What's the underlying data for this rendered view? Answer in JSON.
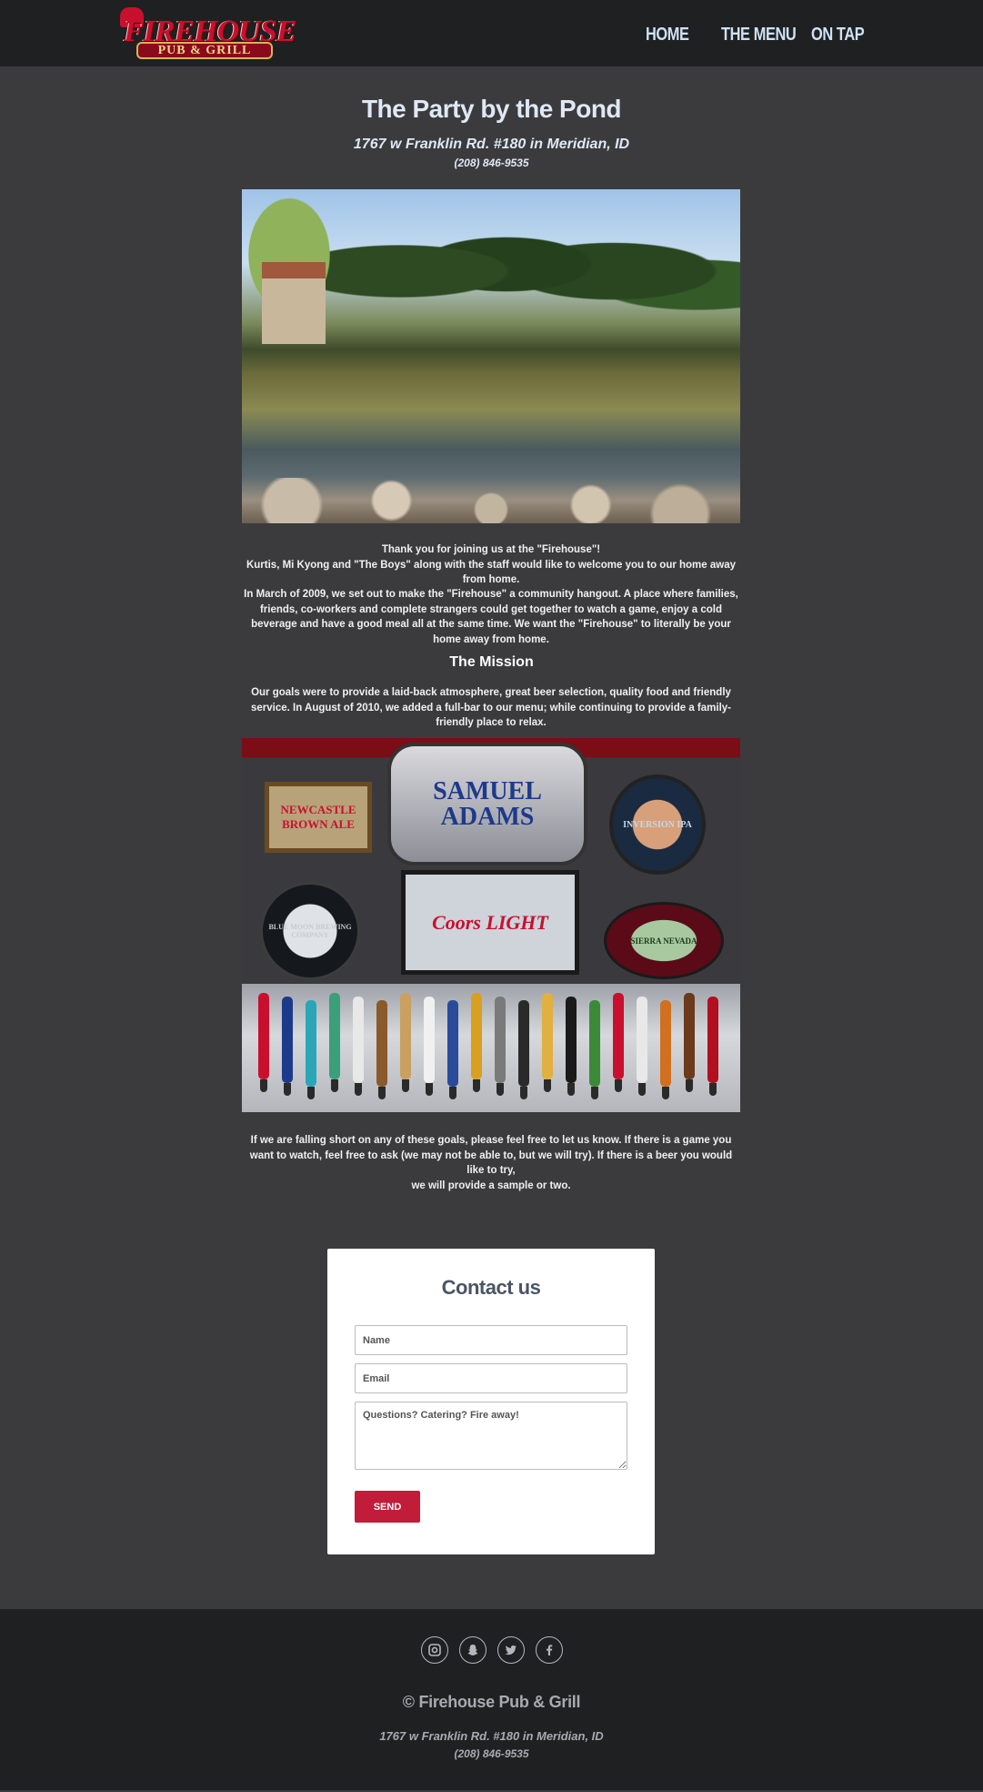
{
  "header": {
    "logo_line1": "FIREHOUSE",
    "logo_line2": "PUB & GRILL",
    "nav": [
      "HOME",
      "THE MENU",
      "ON TAP"
    ]
  },
  "main": {
    "title": "The Party by the Pond",
    "address": "1767 w Franklin Rd. #180 in Meridian, ID",
    "phone": "(208) 846-9535",
    "welcome_line1": "Thank you for joining us at the \"Firehouse\"!",
    "welcome_line2": "Kurtis, Mi Kyong and \"The Boys\" along with the staff would like to welcome you to our home away from home.",
    "history": "In March of 2009, we set out to make the \"Firehouse\" a community hangout. A place where families, friends, co-workers and complete strangers could get together to watch a game, enjoy a cold beverage and have a good meal all at the same time. We want the \"Firehouse\" to literally be your home away from home.",
    "mission_title": "The Mission",
    "mission_text": "Our goals were to provide a laid-back atmosphere, great beer selection, quality food and friendly service. In August of 2010, we added a full-bar to our menu; while continuing to provide a family-friendly place to relax.",
    "closing_line1": "If we are falling short on any of these goals, please feel free to let us know. If there is a game you want to watch, feel free to ask (we may not be able to, but we will try). If there is a beer you would like to try,",
    "closing_line2": "we will provide a sample or two."
  },
  "signs": {
    "samuel_adams": "SAMUEL ADAMS",
    "newcastle": "NEWCASTLE BROWN ALE",
    "inversion": "INVERSION IPA",
    "blue_moon": "BLUE MOON BREWING COMPANY",
    "coors": "Coors LIGHT",
    "sierra": "SIERRA NEVADA"
  },
  "contact": {
    "title": "Contact us",
    "name_placeholder": "Name",
    "email_placeholder": "Email",
    "message_placeholder": "Questions? Catering? Fire away!",
    "send_label": "SEND"
  },
  "footer": {
    "social_icons": [
      "instagram-icon",
      "snapchat-icon",
      "twitter-icon",
      "facebook-icon"
    ],
    "copyright": "© Firehouse Pub & Grill",
    "address": "1767 w Franklin Rd. #180 in Meridian, ID",
    "phone": "(208) 846-9535"
  },
  "colors": {
    "background": "#3b3b3e",
    "header_footer": "#1f2022",
    "nav_text": "#cfe2f3",
    "send_button": "#c21c3b"
  }
}
